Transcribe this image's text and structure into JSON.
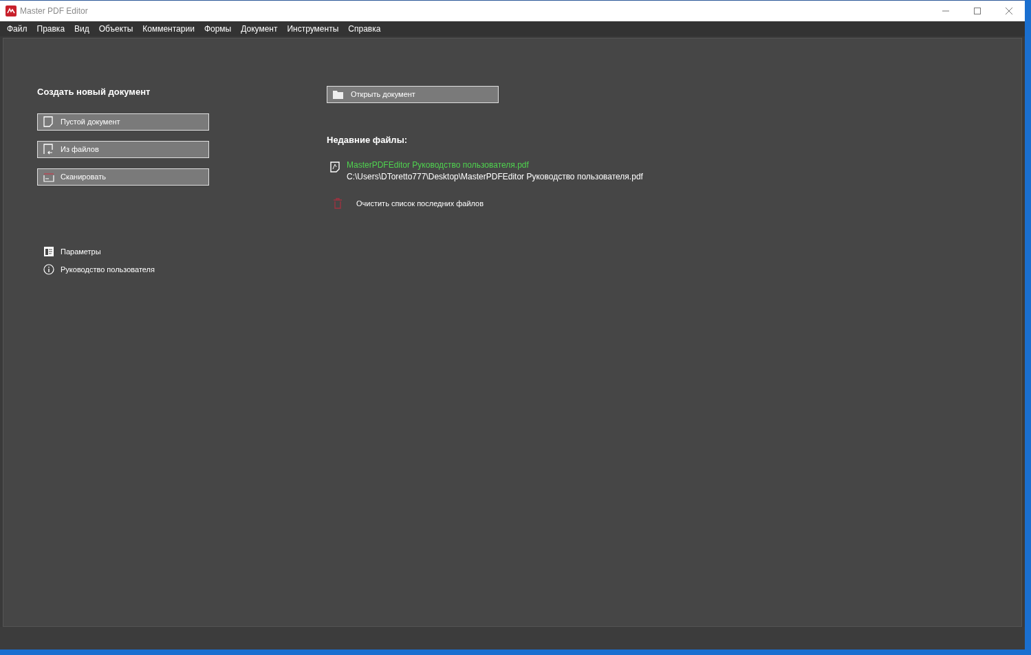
{
  "window": {
    "title": "Master PDF Editor"
  },
  "menu": [
    "Файл",
    "Правка",
    "Вид",
    "Объекты",
    "Комментарии",
    "Формы",
    "Документ",
    "Инструменты",
    "Справка"
  ],
  "create": {
    "heading": "Создать новый документ",
    "buttons": [
      {
        "kind": "blank",
        "label": "Пустой документ"
      },
      {
        "kind": "from-files",
        "label": "Из файлов"
      },
      {
        "kind": "scan",
        "label": "Сканировать"
      }
    ]
  },
  "links": [
    {
      "kind": "settings",
      "label": "Параметры"
    },
    {
      "kind": "info",
      "label": "Руководство пользователя"
    }
  ],
  "open_button": {
    "label": "Открыть документ"
  },
  "recent": {
    "heading": "Недавние файлы:",
    "files": [
      {
        "name": "MasterPDFEditor Руководство пользователя.pdf",
        "path": "C:\\Users\\DToretto777\\Desktop\\MasterPDFEditor Руководство пользователя.pdf"
      }
    ],
    "clear": "Очистить список последних файлов"
  }
}
